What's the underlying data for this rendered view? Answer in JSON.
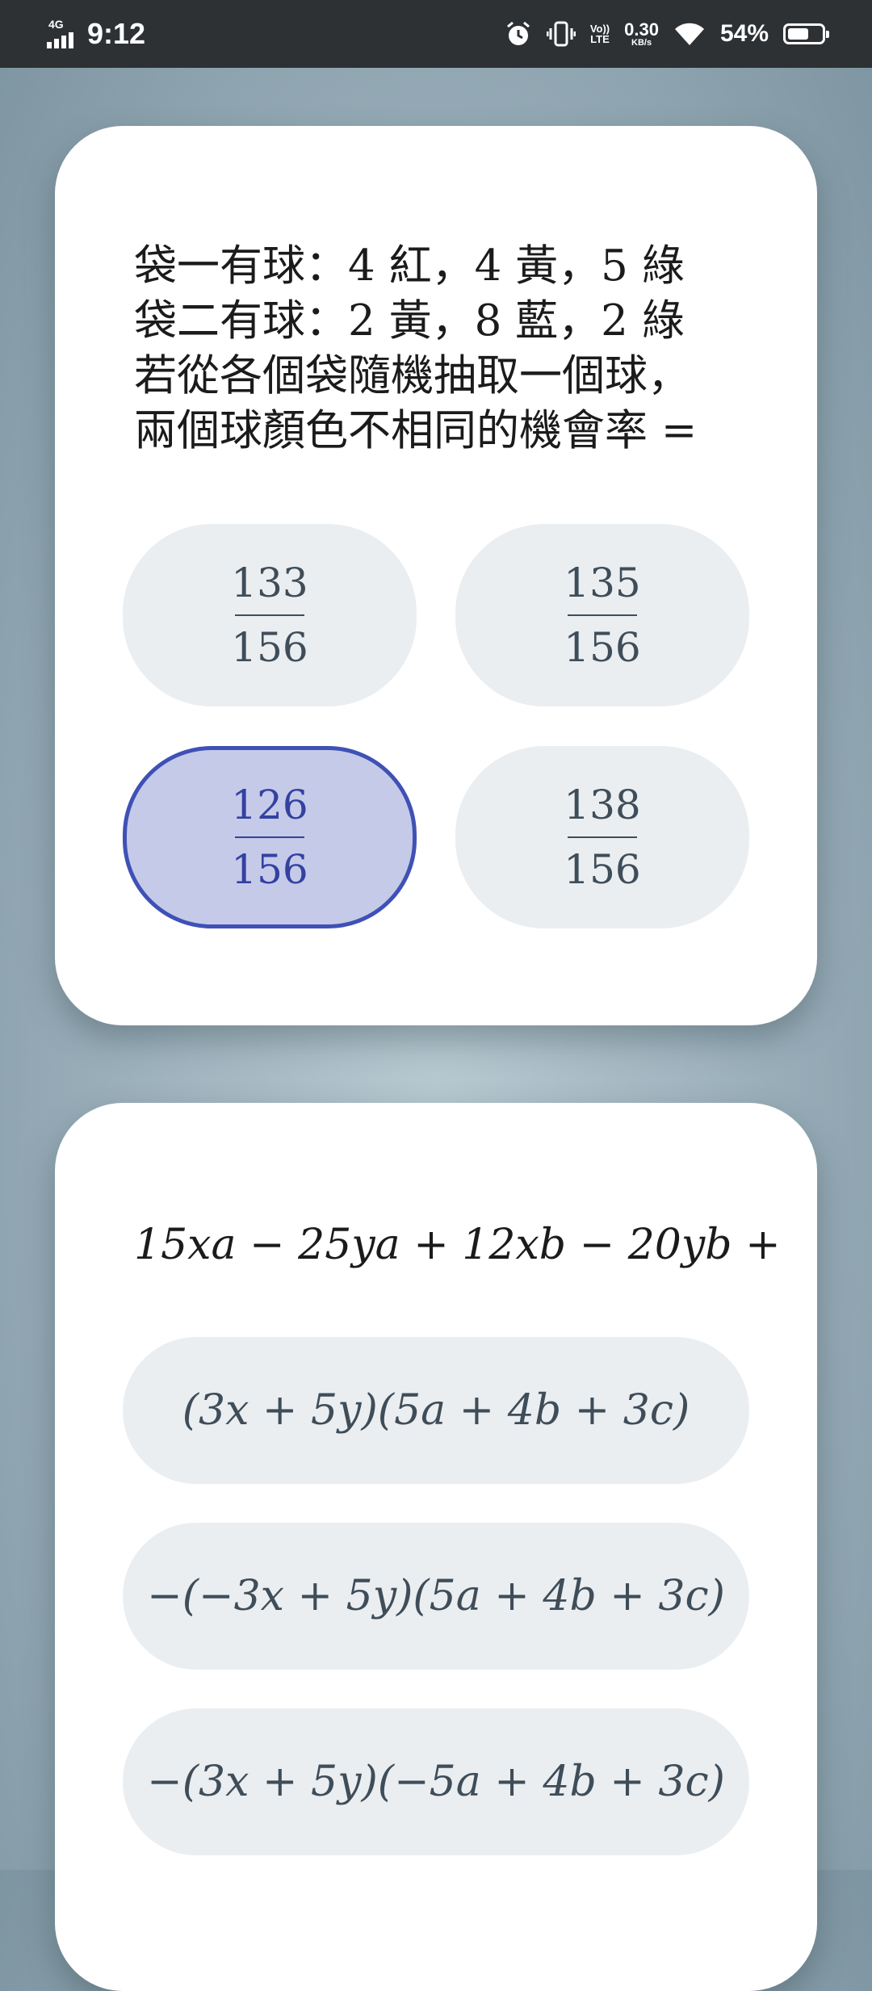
{
  "status_bar": {
    "network": "4G",
    "time": "9:12",
    "volte_top": "Vo))",
    "volte_bottom": "LTE",
    "speed_value": "0.30",
    "speed_unit": "KB/s",
    "battery_percent": "54%",
    "battery_level": 0.54,
    "icons": [
      "alarm-icon",
      "vibrate-icon",
      "wifi-icon",
      "battery-icon"
    ]
  },
  "card1": {
    "question_lines": [
      "袋一有球：4 紅，4 黃，5 綠",
      "袋二有球：2 黃，8 藍，2 綠",
      "若從各個袋隨機抽取一個球，",
      "兩個球顏色不相同的機會率 ="
    ],
    "options": [
      {
        "numerator": "133",
        "denominator": "156",
        "selected": false
      },
      {
        "numerator": "135",
        "denominator": "156",
        "selected": false
      },
      {
        "numerator": "126",
        "denominator": "156",
        "selected": true
      },
      {
        "numerator": "138",
        "denominator": "156",
        "selected": false
      }
    ]
  },
  "card2": {
    "question": "15xa − 25ya + 12xb − 20yb +",
    "options": [
      "(3x + 5y)(5a + 4b + 3c)",
      "−(−3x + 5y)(5a + 4b + 3c)",
      "−(3x + 5y)(−5a + 4b + 3c)"
    ]
  },
  "colors": {
    "selected_border": "#3f51b5",
    "selected_fill": "#c5cae9",
    "option_fill": "#eaeef1"
  }
}
